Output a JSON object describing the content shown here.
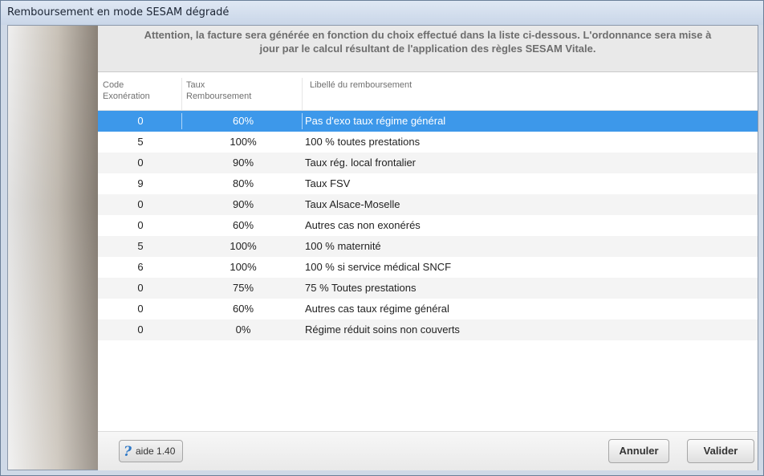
{
  "window": {
    "title": "Remboursement en mode SESAM dégradé"
  },
  "notice": {
    "line1": "Attention, la facture sera générée en fonction du choix effectué dans la liste ci-dessous. L'ordonnance sera mise à",
    "line2": "jour par le calcul résultant de l'application des règles SESAM Vitale."
  },
  "table": {
    "headers": {
      "code_line1": "Code",
      "code_line2": "Exonération",
      "rate_line1": "Taux",
      "rate_line2": "Remboursement",
      "label": "Libellé du remboursement"
    },
    "rows": [
      {
        "code": "0",
        "rate": "60%",
        "label": "Pas d'exo taux régime général",
        "selected": true
      },
      {
        "code": "5",
        "rate": "100%",
        "label": "100 % toutes prestations"
      },
      {
        "code": "0",
        "rate": "90%",
        "label": "Taux rég. local frontalier"
      },
      {
        "code": "9",
        "rate": "80%",
        "label": "Taux FSV"
      },
      {
        "code": "0",
        "rate": "90%",
        "label": "Taux Alsace-Moselle"
      },
      {
        "code": "0",
        "rate": "60%",
        "label": "Autres cas non exonérés"
      },
      {
        "code": "5",
        "rate": "100%",
        "label": "100 % maternité"
      },
      {
        "code": "6",
        "rate": "100%",
        "label": "100 % si service médical SNCF"
      },
      {
        "code": "0",
        "rate": "75%",
        "label": "75 % Toutes prestations"
      },
      {
        "code": "0",
        "rate": "60%",
        "label": "Autres cas taux régime général"
      },
      {
        "code": "0",
        "rate": "0%",
        "label": "Régime réduit soins non couverts"
      }
    ]
  },
  "footer": {
    "help_icon": "question-mark-icon",
    "help_label": "aide 1.40",
    "cancel_label": "Annuler",
    "ok_label": "Valider"
  },
  "colors": {
    "selection": "#3d98ea",
    "notice_text": "#6d6d6d"
  }
}
